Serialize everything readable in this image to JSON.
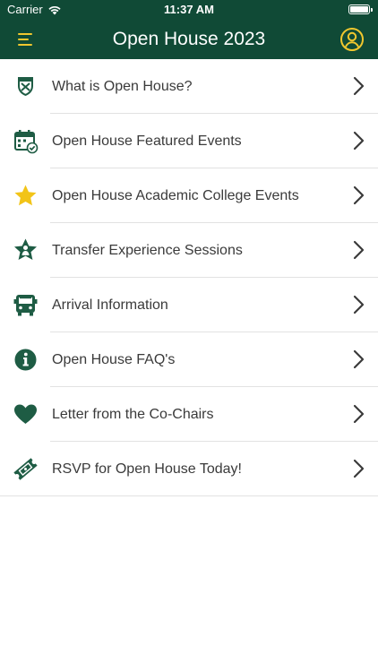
{
  "status_bar": {
    "carrier": "Carrier",
    "time": "11:37 AM"
  },
  "header": {
    "title": "Open House 2023",
    "menu_icon": "hamburger-icon",
    "profile_icon": "user-circle-icon"
  },
  "colors": {
    "primary": "#104a36",
    "accent": "#f0c72e",
    "icon_green": "#1e5c44",
    "star_gold": "#f2c418"
  },
  "menu": {
    "items": [
      {
        "label": "What is Open House?",
        "icon": "university-shield-icon"
      },
      {
        "label": "Open House Featured Events",
        "icon": "calendar-check-icon"
      },
      {
        "label": "Open House Academic College Events",
        "icon": "star-icon"
      },
      {
        "label": "Transfer Experience Sessions",
        "icon": "person-star-icon"
      },
      {
        "label": "Arrival Information",
        "icon": "bus-icon"
      },
      {
        "label": "Open House FAQ's",
        "icon": "info-icon"
      },
      {
        "label": "Letter from the Co-Chairs",
        "icon": "heart-icon"
      },
      {
        "label": "RSVP for Open House Today!",
        "icon": "ticket-icon"
      }
    ]
  }
}
